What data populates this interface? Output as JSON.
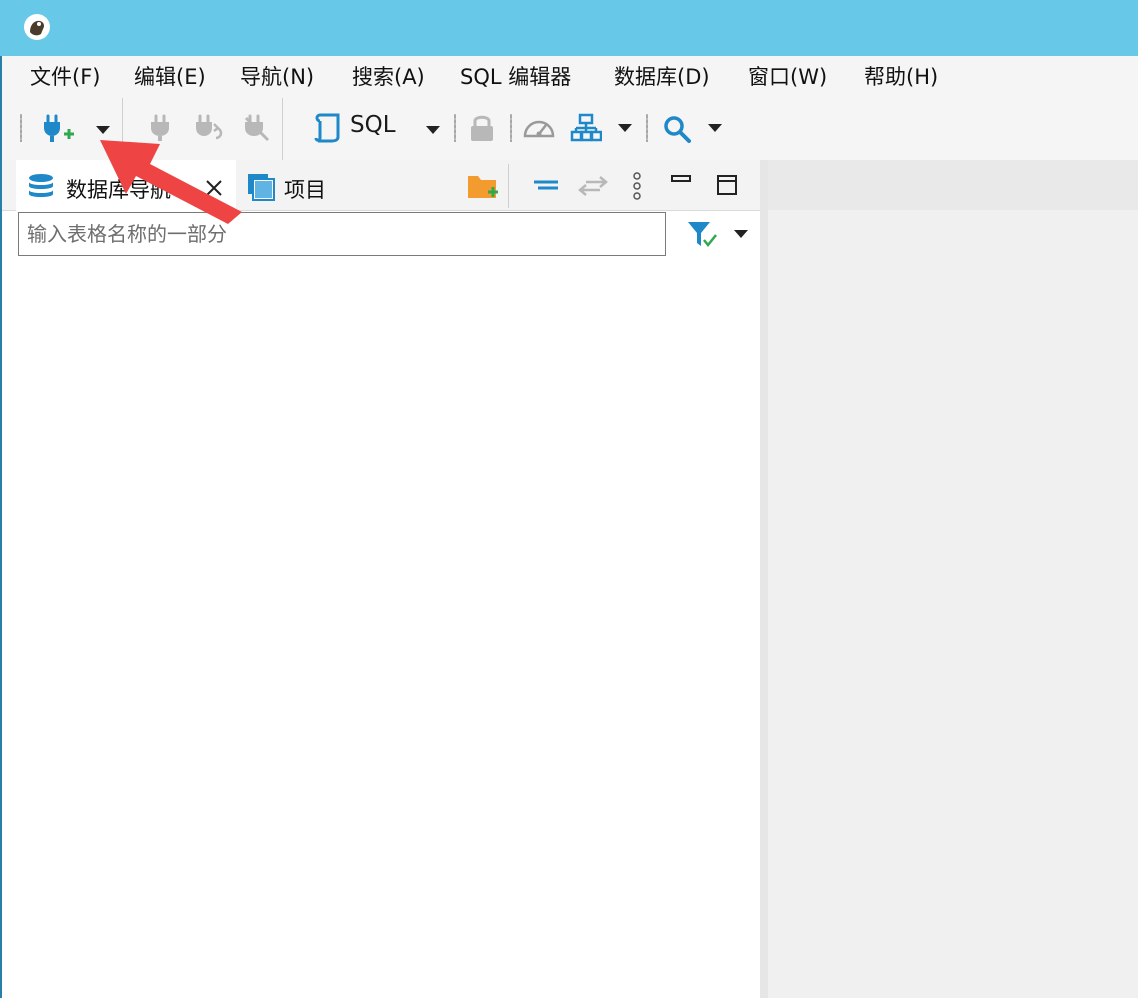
{
  "menu": {
    "file": "文件(F)",
    "edit": "编辑(E)",
    "navigate": "导航(N)",
    "search": "搜索(A)",
    "sql_editor": "SQL 编辑器",
    "database": "数据库(D)",
    "window": "窗口(W)",
    "help": "帮助(H)"
  },
  "toolbar": {
    "sql_label": "SQL"
  },
  "navigator": {
    "tab_database": "数据库导航",
    "tab_projects": "项目",
    "filter_placeholder": "输入表格名称的一部分"
  },
  "colors": {
    "titlebar": "#67c8e8",
    "accent_icon": "#1e88c8",
    "annotation_arrow": "#ee4444"
  }
}
